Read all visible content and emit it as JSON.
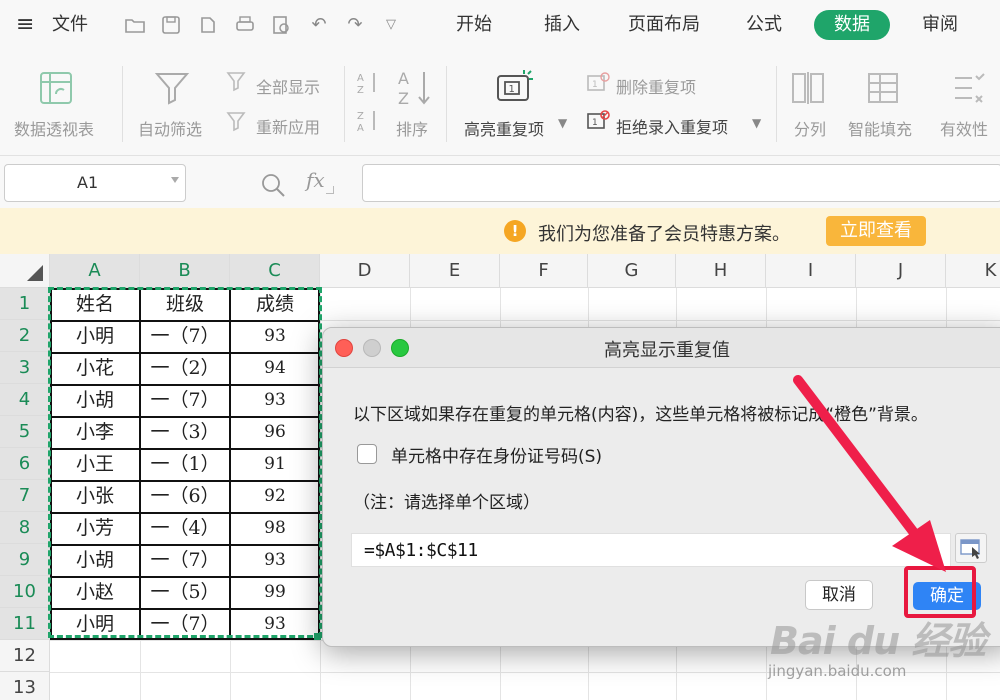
{
  "menubar": {
    "file_label": "文件",
    "tabs": [
      "开始",
      "插入",
      "页面布局",
      "公式",
      "数据",
      "审阅"
    ],
    "active_tab": "数据"
  },
  "ribbon": {
    "pivot": "数据透视表",
    "autofilter": "自动筛选",
    "show_all": "全部显示",
    "reapply": "重新应用",
    "sort": "排序",
    "highlight_dup": "高亮重复项",
    "delete_dup": "删除重复项",
    "reject_dup": "拒绝录入重复项",
    "split_col": "分列",
    "smart_fill": "智能填充",
    "validity": "有效性"
  },
  "formulabar": {
    "cell_ref": "A1",
    "fx": "fx"
  },
  "notice": {
    "icon": "!",
    "text": "我们为您准备了会员特惠方案。",
    "button": "立即查看"
  },
  "sheet": {
    "columns": [
      "A",
      "B",
      "C",
      "D",
      "E",
      "F",
      "G",
      "H",
      "I",
      "J",
      "K"
    ],
    "rows": [
      "1",
      "2",
      "3",
      "4",
      "5",
      "6",
      "7",
      "8",
      "9",
      "10",
      "11",
      "12",
      "13"
    ],
    "header": [
      "姓名",
      "班级",
      "成绩"
    ],
    "data": [
      [
        "小明",
        "一（7）",
        "93"
      ],
      [
        "小花",
        "一（2）",
        "94"
      ],
      [
        "小胡",
        "一（7）",
        "93"
      ],
      [
        "小李",
        "一（3）",
        "96"
      ],
      [
        "小王",
        "一（1）",
        "91"
      ],
      [
        "小张",
        "一（6）",
        "92"
      ],
      [
        "小芳",
        "一（4）",
        "98"
      ],
      [
        "小胡",
        "一（7）",
        "93"
      ],
      [
        "小赵",
        "一（5）",
        "99"
      ],
      [
        "小明",
        "一（7）",
        "93"
      ]
    ]
  },
  "dialog": {
    "title": "高亮显示重复值",
    "description": "以下区域如果存在重复的单元格(内容)，这些单元格将被标记成“橙色”背景。",
    "checkbox_label": "单元格中存在身份证号码(S)",
    "note": "（注：请选择单个区域）",
    "range": "=$A$1:$C$11",
    "cancel": "取消",
    "ok": "确定"
  },
  "watermark": {
    "logo": "Bai du 经验",
    "url": "jingyan.baidu.com"
  },
  "colors": {
    "accent": "#1fa56a",
    "ok_button": "#2f84f5",
    "highlight_box": "#e8183f",
    "notice_bg": "#fdf4d8",
    "notice_btn": "#f9b63b"
  }
}
